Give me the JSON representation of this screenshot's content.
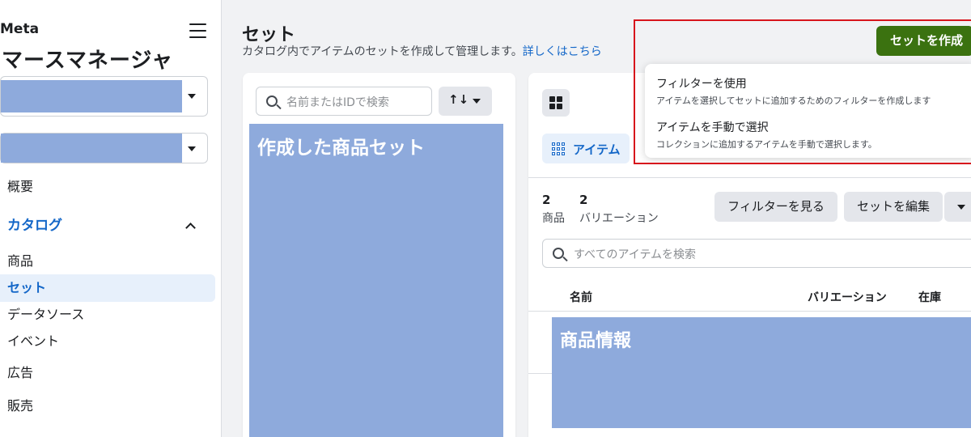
{
  "sidebar": {
    "brand": "Meta",
    "app_title": "マースマネージャ",
    "nav": {
      "overview": "概要",
      "catalog": "カタログ",
      "products": "商品",
      "sets": "セット",
      "data_sources": "データソース",
      "events": "イベント",
      "ads": "広告",
      "sales": "販売"
    }
  },
  "header": {
    "title": "セット",
    "description": "カタログ内でアイテムのセットを作成して管理します。",
    "learn_more": "詳しくはこちら"
  },
  "sets_panel": {
    "search_placeholder": "名前またはIDで検索",
    "sort_label": "↑↓",
    "redacted_label": "作成した商品セット"
  },
  "items_panel": {
    "tab_items": "アイテム",
    "products_count": "2",
    "products_label": "商品",
    "variations_count": "2",
    "variations_label": "バリエーション",
    "view_filter": "フィルターを見る",
    "edit_set": "セットを編集",
    "search_placeholder": "すべてのアイテムを検索",
    "columns": {
      "name": "名前",
      "variations": "バリエーション",
      "stock": "在庫"
    },
    "redacted_label": "商品情報"
  },
  "create": {
    "button": "セットを作成",
    "menu": [
      {
        "title": "フィルターを使用",
        "desc": "アイテムを選択してセットに追加するためのフィルターを作成します"
      },
      {
        "title": "アイテムを手動で選択",
        "desc": "コレクションに追加するアイテムを手動で選択します。"
      }
    ]
  },
  "colors": {
    "accent": "#1467c8",
    "create_button": "#3b7210",
    "redaction": "#8eaadc",
    "highlight": "#d7151c"
  }
}
